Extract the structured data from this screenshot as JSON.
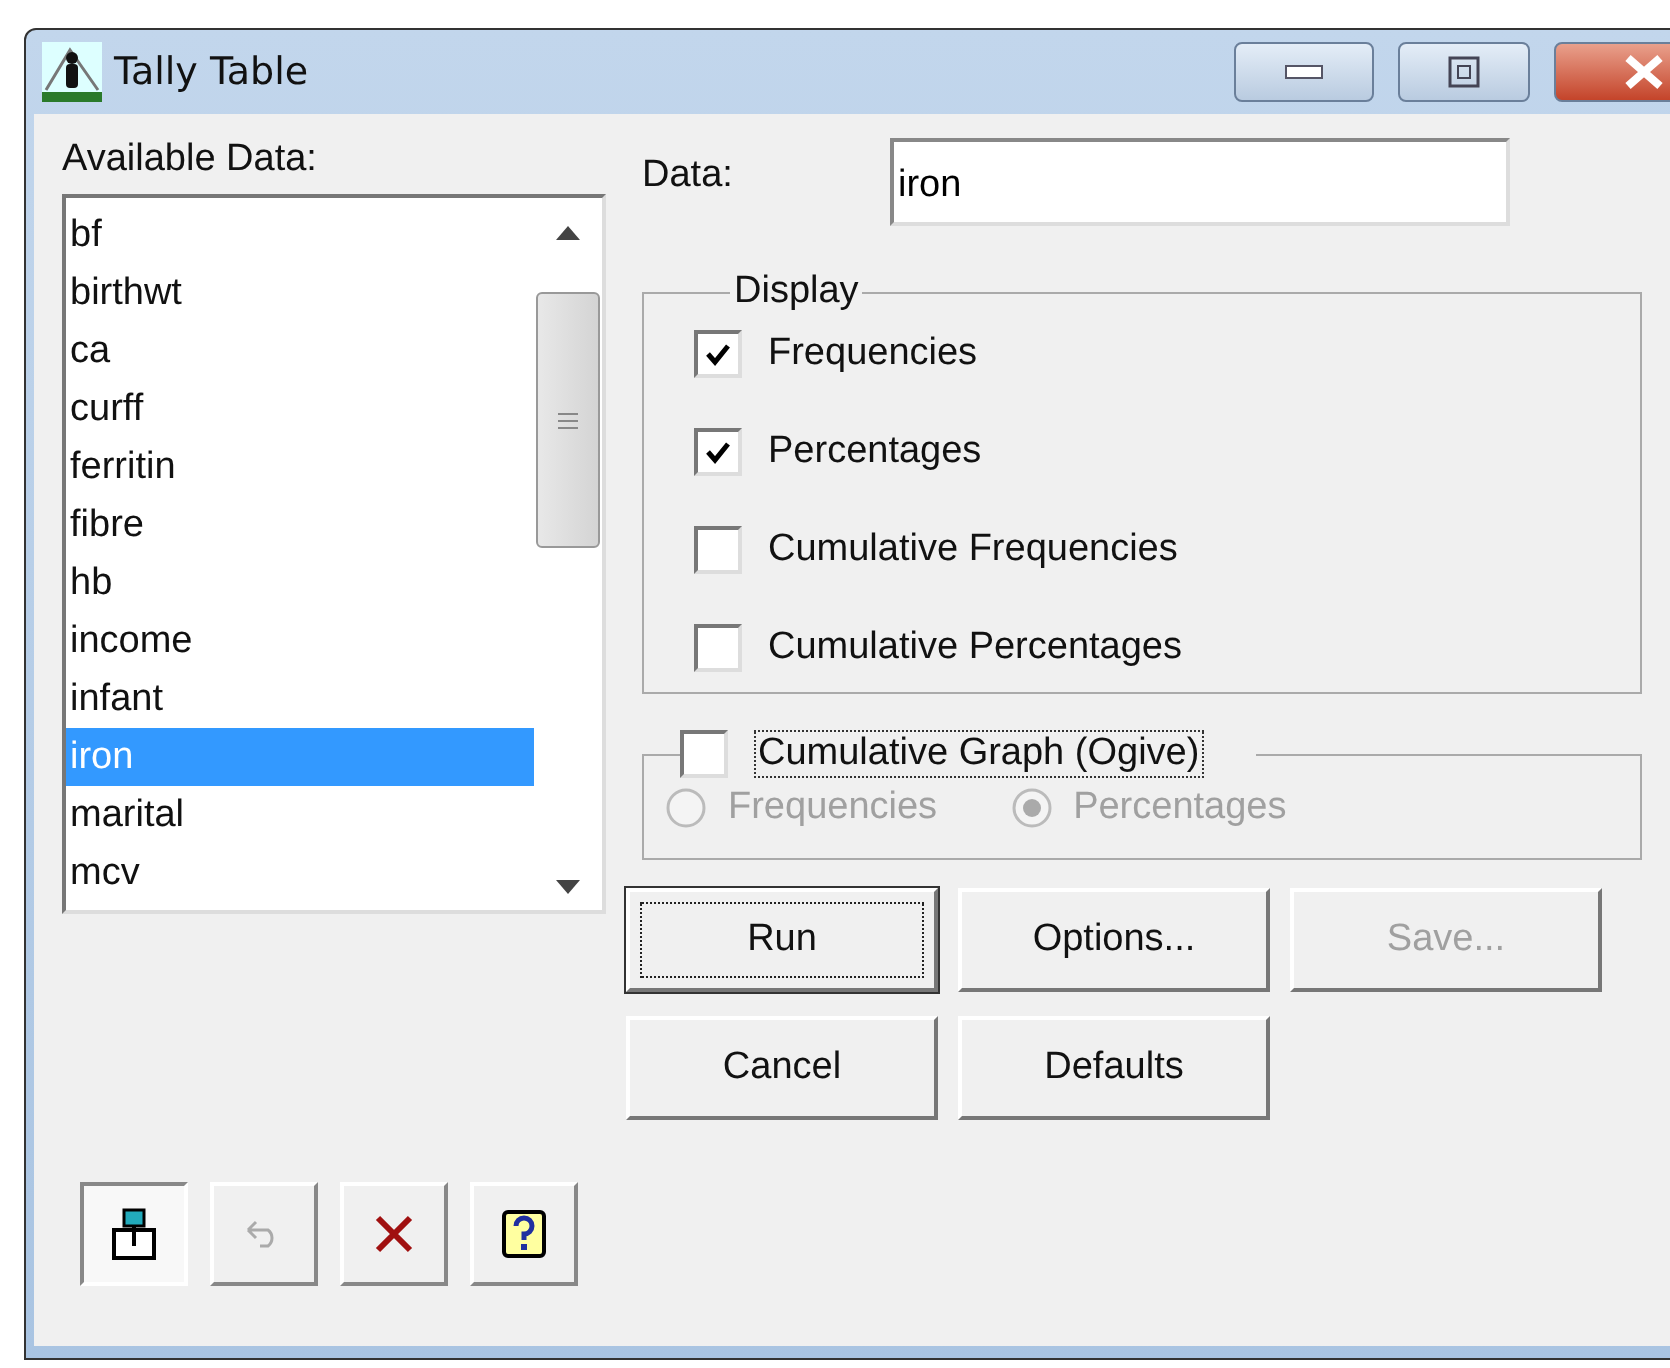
{
  "window": {
    "title": "Tally Table"
  },
  "available_data": {
    "label": "Available Data:",
    "items": [
      {
        "label": "bf",
        "selected": false
      },
      {
        "label": "birthwt",
        "selected": false
      },
      {
        "label": "ca",
        "selected": false
      },
      {
        "label": "curff",
        "selected": false
      },
      {
        "label": "ferritin",
        "selected": false
      },
      {
        "label": "fibre",
        "selected": false
      },
      {
        "label": "hb",
        "selected": false
      },
      {
        "label": "income",
        "selected": false
      },
      {
        "label": "infant",
        "selected": false
      },
      {
        "label": "iron",
        "selected": true
      },
      {
        "label": "marital",
        "selected": false
      },
      {
        "label": "mcv",
        "selected": false
      }
    ]
  },
  "data_field": {
    "label": "Data:",
    "value": "iron"
  },
  "display": {
    "title": "Display",
    "options": [
      {
        "label": "Frequencies",
        "checked": true
      },
      {
        "label": "Percentages",
        "checked": true
      },
      {
        "label": "Cumulative Frequencies",
        "checked": false
      },
      {
        "label": "Cumulative Percentages",
        "checked": false
      }
    ]
  },
  "ogive": {
    "label": "Cumulative Graph (Ogive)",
    "checked": false,
    "options": [
      {
        "label": "Frequencies",
        "selected": false
      },
      {
        "label": "Percentages",
        "selected": true
      }
    ]
  },
  "tool_buttons": [
    {
      "kind": "pin",
      "disabled": false,
      "pressed": true
    },
    {
      "kind": "undo",
      "disabled": true,
      "pressed": false
    },
    {
      "kind": "delete",
      "disabled": false,
      "pressed": false
    },
    {
      "kind": "help",
      "disabled": false,
      "pressed": false
    }
  ],
  "action_rows": [
    [
      {
        "label": "Run",
        "disabled": false,
        "focused": true
      },
      {
        "label": "Options...",
        "disabled": false,
        "focused": false
      },
      {
        "label": "Save...",
        "disabled": true,
        "focused": false
      }
    ],
    [
      {
        "label": "Cancel",
        "disabled": false,
        "focused": false
      },
      {
        "label": "Defaults",
        "disabled": false,
        "focused": false
      }
    ]
  ]
}
